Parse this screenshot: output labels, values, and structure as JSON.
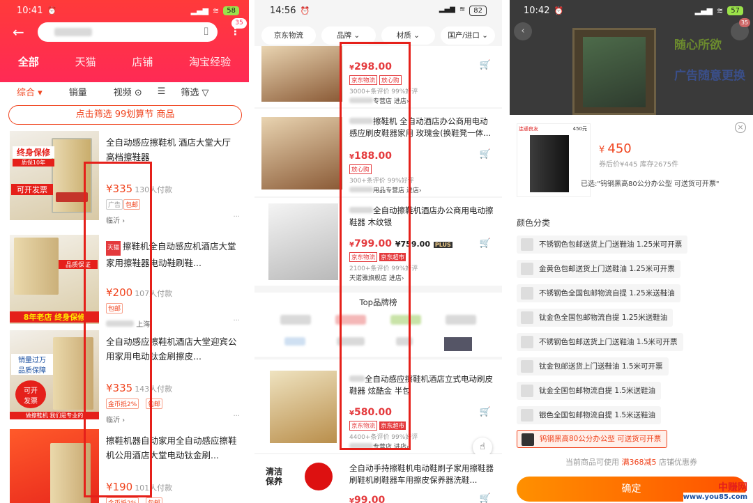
{
  "p1": {
    "status": {
      "time": "10:41",
      "battery": "58"
    },
    "cart_badge": "35",
    "tabs": [
      "全部",
      "天猫",
      "店铺",
      "淘宝经验"
    ],
    "sort": [
      "综合",
      "销量",
      "视频",
      "筛选"
    ],
    "promo": "点击筛选 99划算节 商品",
    "items": [
      {
        "title": "全自动感应擦鞋机 酒店大堂大厅 高档擦鞋器",
        "price": "¥335",
        "sold": "130人付款",
        "tags": [
          "广告",
          "包邮"
        ],
        "loc": "临沂"
      },
      {
        "title": "擦鞋机全自动感应机酒店大堂家用擦鞋器电动鞋刷鞋...",
        "price": "¥200",
        "sold": "107人付款",
        "tags": [
          "包邮"
        ],
        "loc": "上海",
        "mall": "天猫"
      },
      {
        "title": "全自动感应擦鞋机酒店大堂迎宾公用家用电动钛金刷擦皮...",
        "price": "¥335",
        "sold": "143人付款",
        "tags": [
          "金币抵2%",
          "包邮"
        ],
        "loc": "临沂"
      },
      {
        "title": "擦鞋机器自动家用全自动感应擦鞋机公用酒店大堂电动钛金刷...",
        "price": "¥190",
        "sold": "101人付款",
        "tags": [
          "金币抵2%",
          "包邮"
        ],
        "loc": ""
      }
    ],
    "thumb_text": [
      "终身保修",
      "质保10年",
      "可开发票",
      "8年老店",
      "终身保修",
      "品质保证",
      "销量过万",
      "品质保障",
      "可开",
      "发票",
      "做擦鞋机 我们是专业的"
    ]
  },
  "p2": {
    "status": {
      "time": "14:56",
      "battery": "82"
    },
    "chips": [
      "京东物流",
      "品牌",
      "材质",
      "国产/进口"
    ],
    "items": [
      {
        "title": "",
        "price": "298.00",
        "tags": [
          "京东物流",
          "放心购"
        ],
        "meta": "3000+条评价  99%好评",
        "shop": "专营店  进店"
      },
      {
        "title": "擦鞋机 全自动酒店办公商用电动感应刷皮鞋器家用 玫瑰金(换鞋凳一体...",
        "price": "188.00",
        "tags": [
          "放心购"
        ],
        "meta": "300+条评价  99%好评",
        "shop": "用品专营店  进店"
      },
      {
        "title": "全自动擦鞋机酒店办公商用电动擦鞋器 木纹银",
        "price": "799.00",
        "plus": "¥759.00",
        "plus_label": "PLUS",
        "tags": [
          "京东物流",
          "京东超市"
        ],
        "meta": "2100+条评价  99%好评",
        "shop": "天诺雅旗舰店  进店"
      },
      {
        "title": "全自动感应擦鞋机酒店立式电动刷皮鞋器 炫酷金 半包",
        "price": "580.00",
        "tags": [
          "京东物流",
          "京东超市"
        ],
        "meta": "4400+条评价  99%好评",
        "shop": "专营店  进店"
      },
      {
        "title": "全自动手持擦鞋机电动鞋刷子家用擦鞋器刷鞋机刷鞋器车用擦皮保养器洗鞋...",
        "price": "99.00",
        "tags": [],
        "meta": "",
        "shop": ""
      }
    ],
    "top_brand": "Top品牌榜",
    "promo_text": [
      "清洁",
      "保养"
    ]
  },
  "p3": {
    "status": {
      "time": "10:42",
      "battery": "57"
    },
    "banner": [
      "随心所欲",
      "广告随意更换"
    ],
    "shop_label": "连通良友",
    "thumb_price": "450元",
    "price": "450",
    "after": "券后价¥445 库存2675件",
    "selected": "已选:\"钨钢黑高80公分办公型 可送货可开票\"",
    "section": "颜色分类",
    "specs": [
      "不锈钢色包邮送货上门送鞋油 1.25米可开票",
      "金黄色包邮送货上门送鞋油 1.25米可开票",
      "不锈钢色全国包邮物流自提 1.25米送鞋油",
      "钛金色全国包邮物流自提 1.25米送鞋油",
      "不锈钢色包邮送货上门送鞋油 1.5米可开票",
      "钛金包邮送货上门送鞋油 1.5米可开票",
      "钛金全国包邮物流自提 1.5米送鞋油",
      "银色全国包邮物流自提 1.5米送鞋油",
      "钨钢黑高80公分办公型 可送货可开票"
    ],
    "coupon_pre": "当前商品可使用 ",
    "coupon": "满368减5",
    "coupon_post": " 店铺优惠券",
    "confirm": "确定",
    "cart_badge": "35",
    "watermark": [
      "中赚网",
      "www.you85.com"
    ]
  },
  "colors": {
    "taobao": "#ff2a55",
    "jd": "#e4393c",
    "orange": "#ff5000",
    "highlight": "#e5201a"
  }
}
